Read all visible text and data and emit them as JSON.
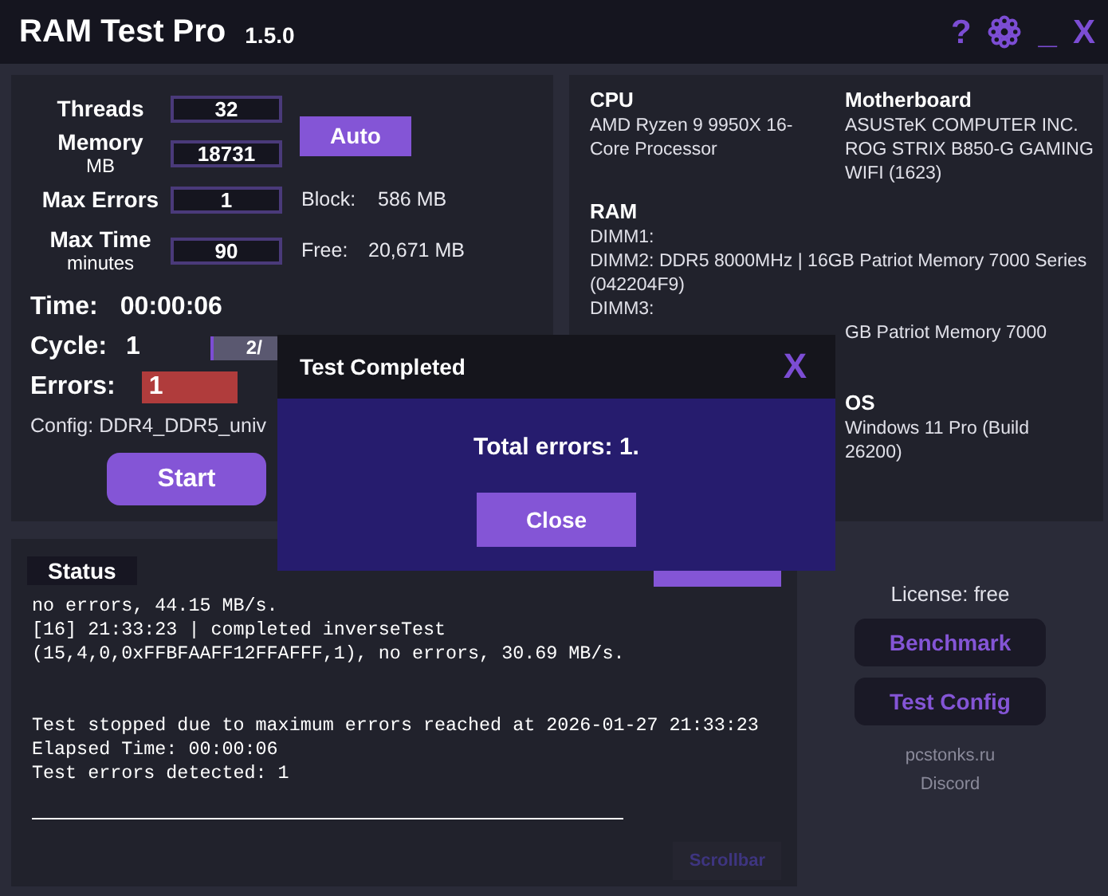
{
  "title_bar": {
    "title": "RAM Test Pro",
    "version": "1.5.0",
    "help": "?",
    "minimize": "_",
    "close": "X"
  },
  "settings": {
    "fields": [
      {
        "label": "Threads",
        "value": "32"
      },
      {
        "label": "Memory",
        "unit": "MB",
        "value": "18731"
      },
      {
        "label": "Max Errors",
        "value": "1"
      },
      {
        "label": "Max Time",
        "unit": "minutes",
        "value": "90"
      }
    ],
    "auto_button": "Auto",
    "block": {
      "label": "Block:",
      "value": "586 MB"
    },
    "free": {
      "label": "Free:",
      "value": "20,671 MB"
    }
  },
  "progress": {
    "time_label": "Time:",
    "time": "00:00:06",
    "cycle_label": "Cycle:",
    "cycle": "1",
    "cycle_bar": {
      "text": "2/",
      "level": 0.03
    },
    "errors_label": "Errors:",
    "errors": "1",
    "errors_alert": true,
    "config": "Config: DDR4_DDR5_univ",
    "start_button": "Start"
  },
  "system": {
    "cpu": {
      "label": "CPU",
      "lines": [
        "AMD Ryzen 9 9950X 16-Core Processor"
      ]
    },
    "motherboard": {
      "label": "Motherboard",
      "lines": [
        "ASUSTeK COMPUTER INC.",
        "ROG STRIX B850-G GAMING WIFI (1623)"
      ]
    },
    "ram": {
      "label": "RAM",
      "lines": [
        "DIMM1:",
        "DIMM2: DDR5 8000MHz | 16GB Patriot Memory 7000 Series (042204F9)",
        "DIMM3:"
      ],
      "partial_line": "GB Patriot Memory 7000"
    },
    "os": {
      "label": "OS",
      "lines": [
        "Windows 11 Pro (Build 26200)"
      ]
    }
  },
  "status": {
    "title": "Status",
    "log_blocks": [
      [
        "no errors, 44.15 MB/s.",
        "[16] 21:33:23 | completed inverseTest",
        "(15,4,0,0xFFBFAAFF12FFAFFF,1), no errors, 30.69 MB/s."
      ],
      [
        "Test stopped due to maximum errors reached at 2026-01-27 21:33:23",
        "Elapsed Time: 00:00:06",
        "Test errors detected: 1"
      ]
    ],
    "scrollbar_button": "Scrollbar"
  },
  "side": {
    "license": "License: free",
    "buttons": [
      "Benchmark",
      "Test Config"
    ],
    "links": [
      "pcstonks.ru",
      "Discord"
    ]
  },
  "dialog": {
    "title": "Test Completed",
    "close": "X",
    "message": "Total errors: 1.",
    "button": "Close"
  }
}
